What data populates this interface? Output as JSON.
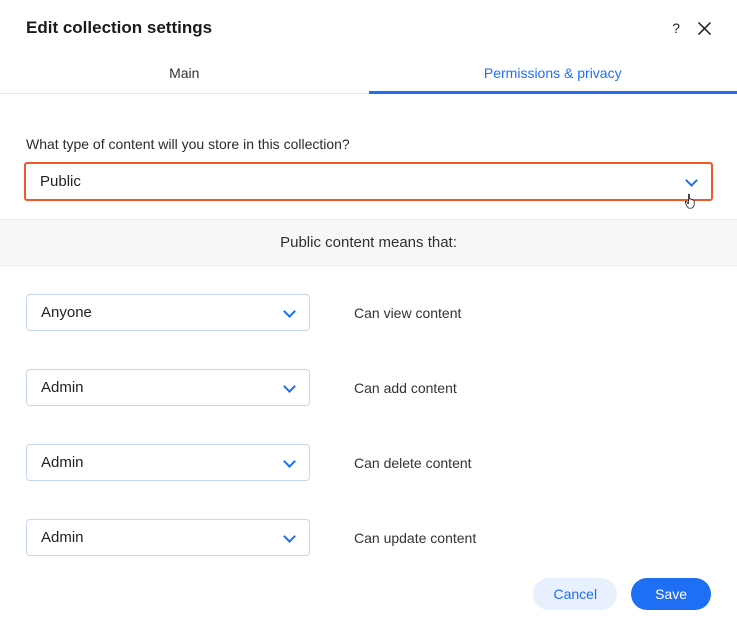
{
  "header": {
    "title": "Edit collection settings"
  },
  "tabs": {
    "main": "Main",
    "permissions": "Permissions & privacy"
  },
  "prompt": "What type of content will you store in this collection?",
  "content_type_selected": "Public",
  "info_bar": "Public content means that:",
  "permissions": [
    {
      "role": "Anyone",
      "label": "Can view content"
    },
    {
      "role": "Admin",
      "label": "Can add content"
    },
    {
      "role": "Admin",
      "label": "Can delete content"
    },
    {
      "role": "Admin",
      "label": "Can update content"
    }
  ],
  "footer": {
    "cancel": "Cancel",
    "save": "Save"
  }
}
